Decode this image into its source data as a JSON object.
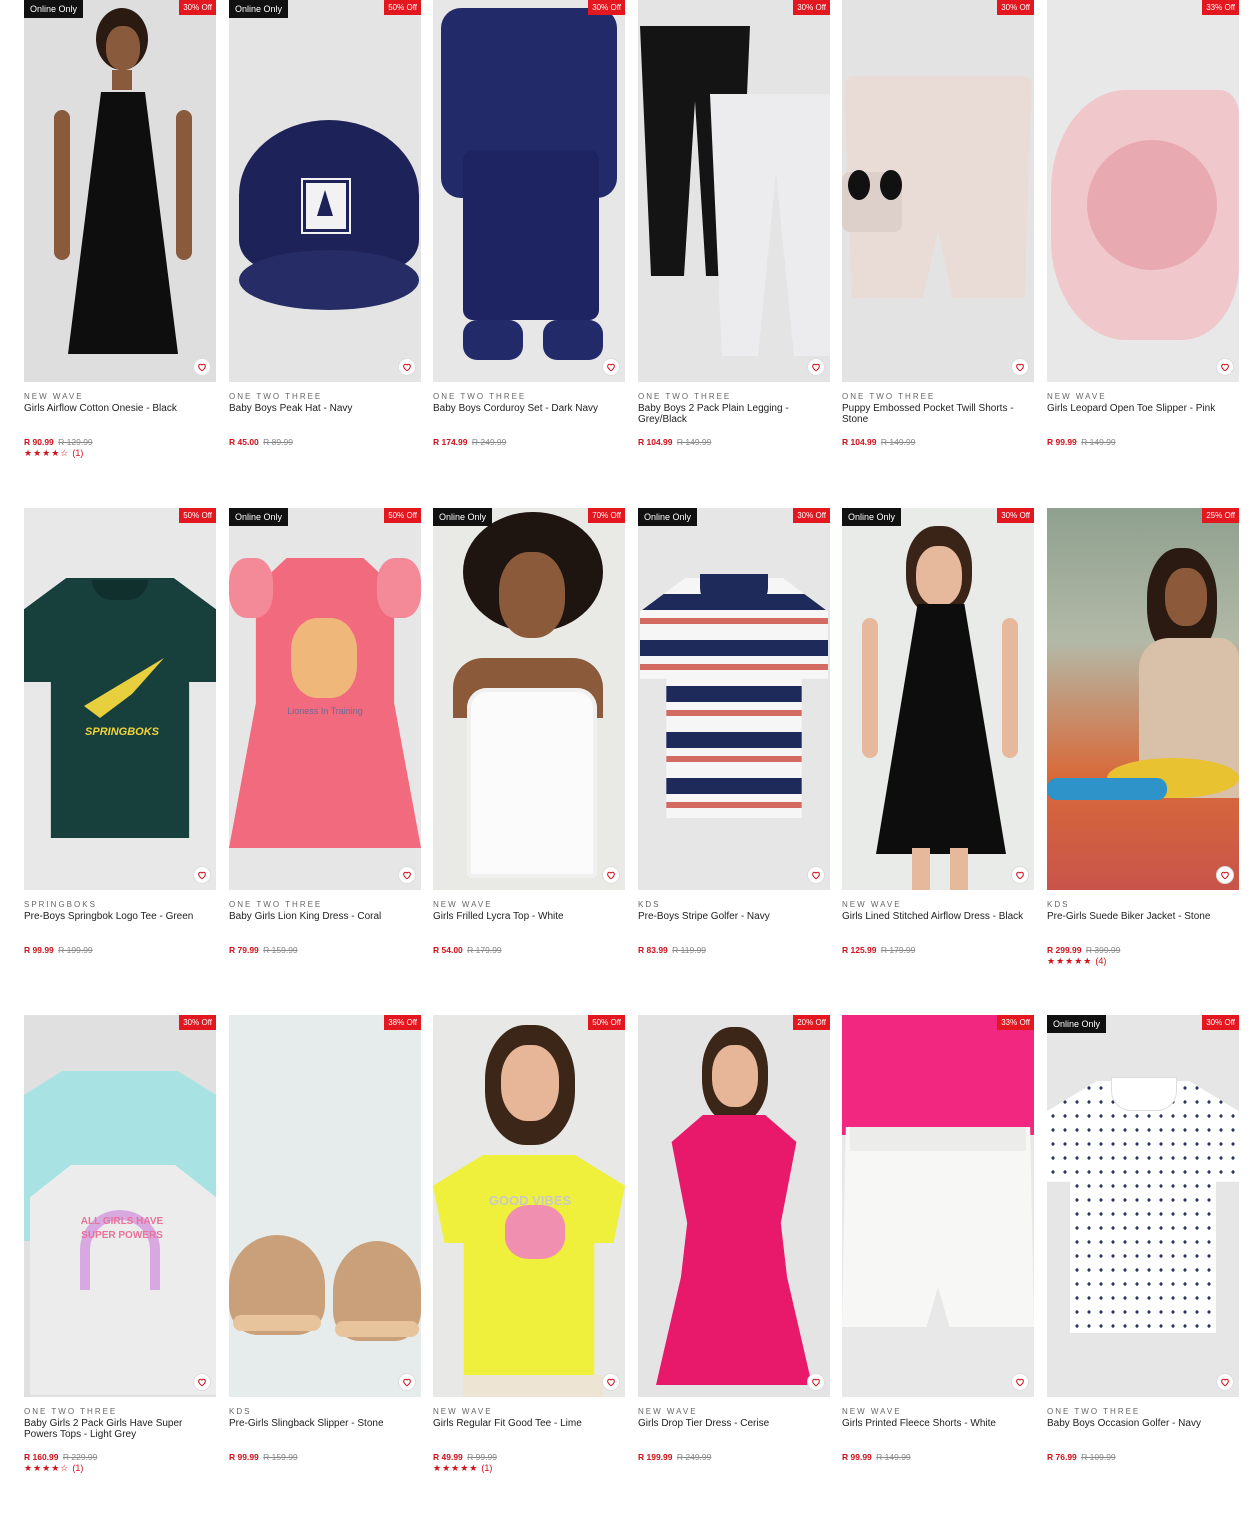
{
  "heart_icon": "heart-outline-icon",
  "colors": {
    "sale_red": "#e3171f",
    "price_red": "#d0101a",
    "badge_black": "#111111"
  },
  "products": [
    {
      "brand": "NEW WAVE",
      "name": "Girls Airflow Cotton Onesie - Black",
      "price": "R 90.99",
      "was": "R 129.99",
      "online": "Online Only",
      "discount": "30% Off",
      "stars": "★★★★☆",
      "rating_count": "(1)"
    },
    {
      "brand": "ONE TWO THREE",
      "name": "Baby Boys Peak Hat - Navy",
      "price": "R 45.00",
      "was": "R 89.99",
      "online": "Online Only",
      "discount": "50% Off"
    },
    {
      "brand": "ONE TWO THREE",
      "name": "Baby Boys Corduroy Set - Dark Navy",
      "price": "R 174.99",
      "was": "R 249.99",
      "discount": "30% Off"
    },
    {
      "brand": "ONE TWO THREE",
      "name": "Baby Boys 2 Pack Plain Legging - Grey/Black",
      "price": "R 104.99",
      "was": "R 149.99",
      "discount": "30% Off"
    },
    {
      "brand": "ONE TWO THREE",
      "name": "Puppy Embossed Pocket Twill Shorts - Stone",
      "price": "R 104.99",
      "was": "R 149.99",
      "discount": "30% Off"
    },
    {
      "brand": "NEW WAVE",
      "name": "Girls Leopard Open Toe Slipper - Pink",
      "price": "R 99.99",
      "was": "R 149.99",
      "discount": "33% Off"
    },
    {
      "brand": "SPRINGBOKS",
      "name": "Pre-Boys Springbok Logo Tee - Green",
      "price": "R 99.99",
      "was": "R 199.99",
      "discount": "50% Off",
      "print_text": "SPRINGBOKS"
    },
    {
      "brand": "ONE TWO THREE",
      "name": "Baby Girls Lion King Dress - Coral",
      "price": "R 79.99",
      "was": "R 159.99",
      "online": "Online Only",
      "discount": "50% Off",
      "print_text": "Lioness In Training"
    },
    {
      "brand": "NEW WAVE",
      "name": "Girls Frilled Lycra Top - White",
      "price": "R 54.00",
      "was": "R 179.99",
      "online": "Online Only",
      "discount": "70% Off"
    },
    {
      "brand": "KDS",
      "name": "Pre-Boys Stripe Golfer - Navy",
      "price": "R 83.99",
      "was": "R 119.99",
      "online": "Online Only",
      "discount": "30% Off"
    },
    {
      "brand": "NEW WAVE",
      "name": "Girls Lined Stitched Airflow Dress - Black",
      "price": "R 125.99",
      "was": "R 179.99",
      "online": "Online Only",
      "discount": "30% Off"
    },
    {
      "brand": "KDS",
      "name": "Pre-Girls Suede Biker Jacket - Stone",
      "price": "R 299.99",
      "was": "R 399.99",
      "discount": "25% Off",
      "stars": "★★★★★",
      "rating_count": "(4)"
    },
    {
      "brand": "ONE TWO THREE",
      "name": "Baby Girls 2 Pack Girls Have Super Powers Tops - Light Grey",
      "price": "R 160.99",
      "was": "R 229.99",
      "discount": "30% Off",
      "stars": "★★★★☆",
      "rating_count": "(1)",
      "print_text": "ALL GIRLS HAVE SUPER POWERS"
    },
    {
      "brand": "KDS",
      "name": "Pre-Girls Slingback Slipper - Stone",
      "price": "R 99.99",
      "was": "R 159.99",
      "discount": "38% Off"
    },
    {
      "brand": "NEW WAVE",
      "name": "Girls Regular Fit Good Tee - Lime",
      "price": "R 49.99",
      "was": "R 99.99",
      "discount": "50% Off",
      "stars": "★★★★★",
      "rating_count": "(1)",
      "print_text": "GOOD VIBES"
    },
    {
      "brand": "NEW WAVE",
      "name": "Girls Drop Tier Dress - Cerise",
      "price": "R 199.99",
      "was": "R 249.99",
      "discount": "20% Off"
    },
    {
      "brand": "NEW WAVE",
      "name": "Girls Printed Fleece Shorts - White",
      "price": "R 99.99",
      "was": "R 149.99",
      "discount": "33% Off"
    },
    {
      "brand": "ONE TWO THREE",
      "name": "Baby Boys Occasion Golfer - Navy",
      "price": "R 76.99",
      "was": "R 109.99",
      "online": "Online Only",
      "discount": "30% Off"
    }
  ]
}
